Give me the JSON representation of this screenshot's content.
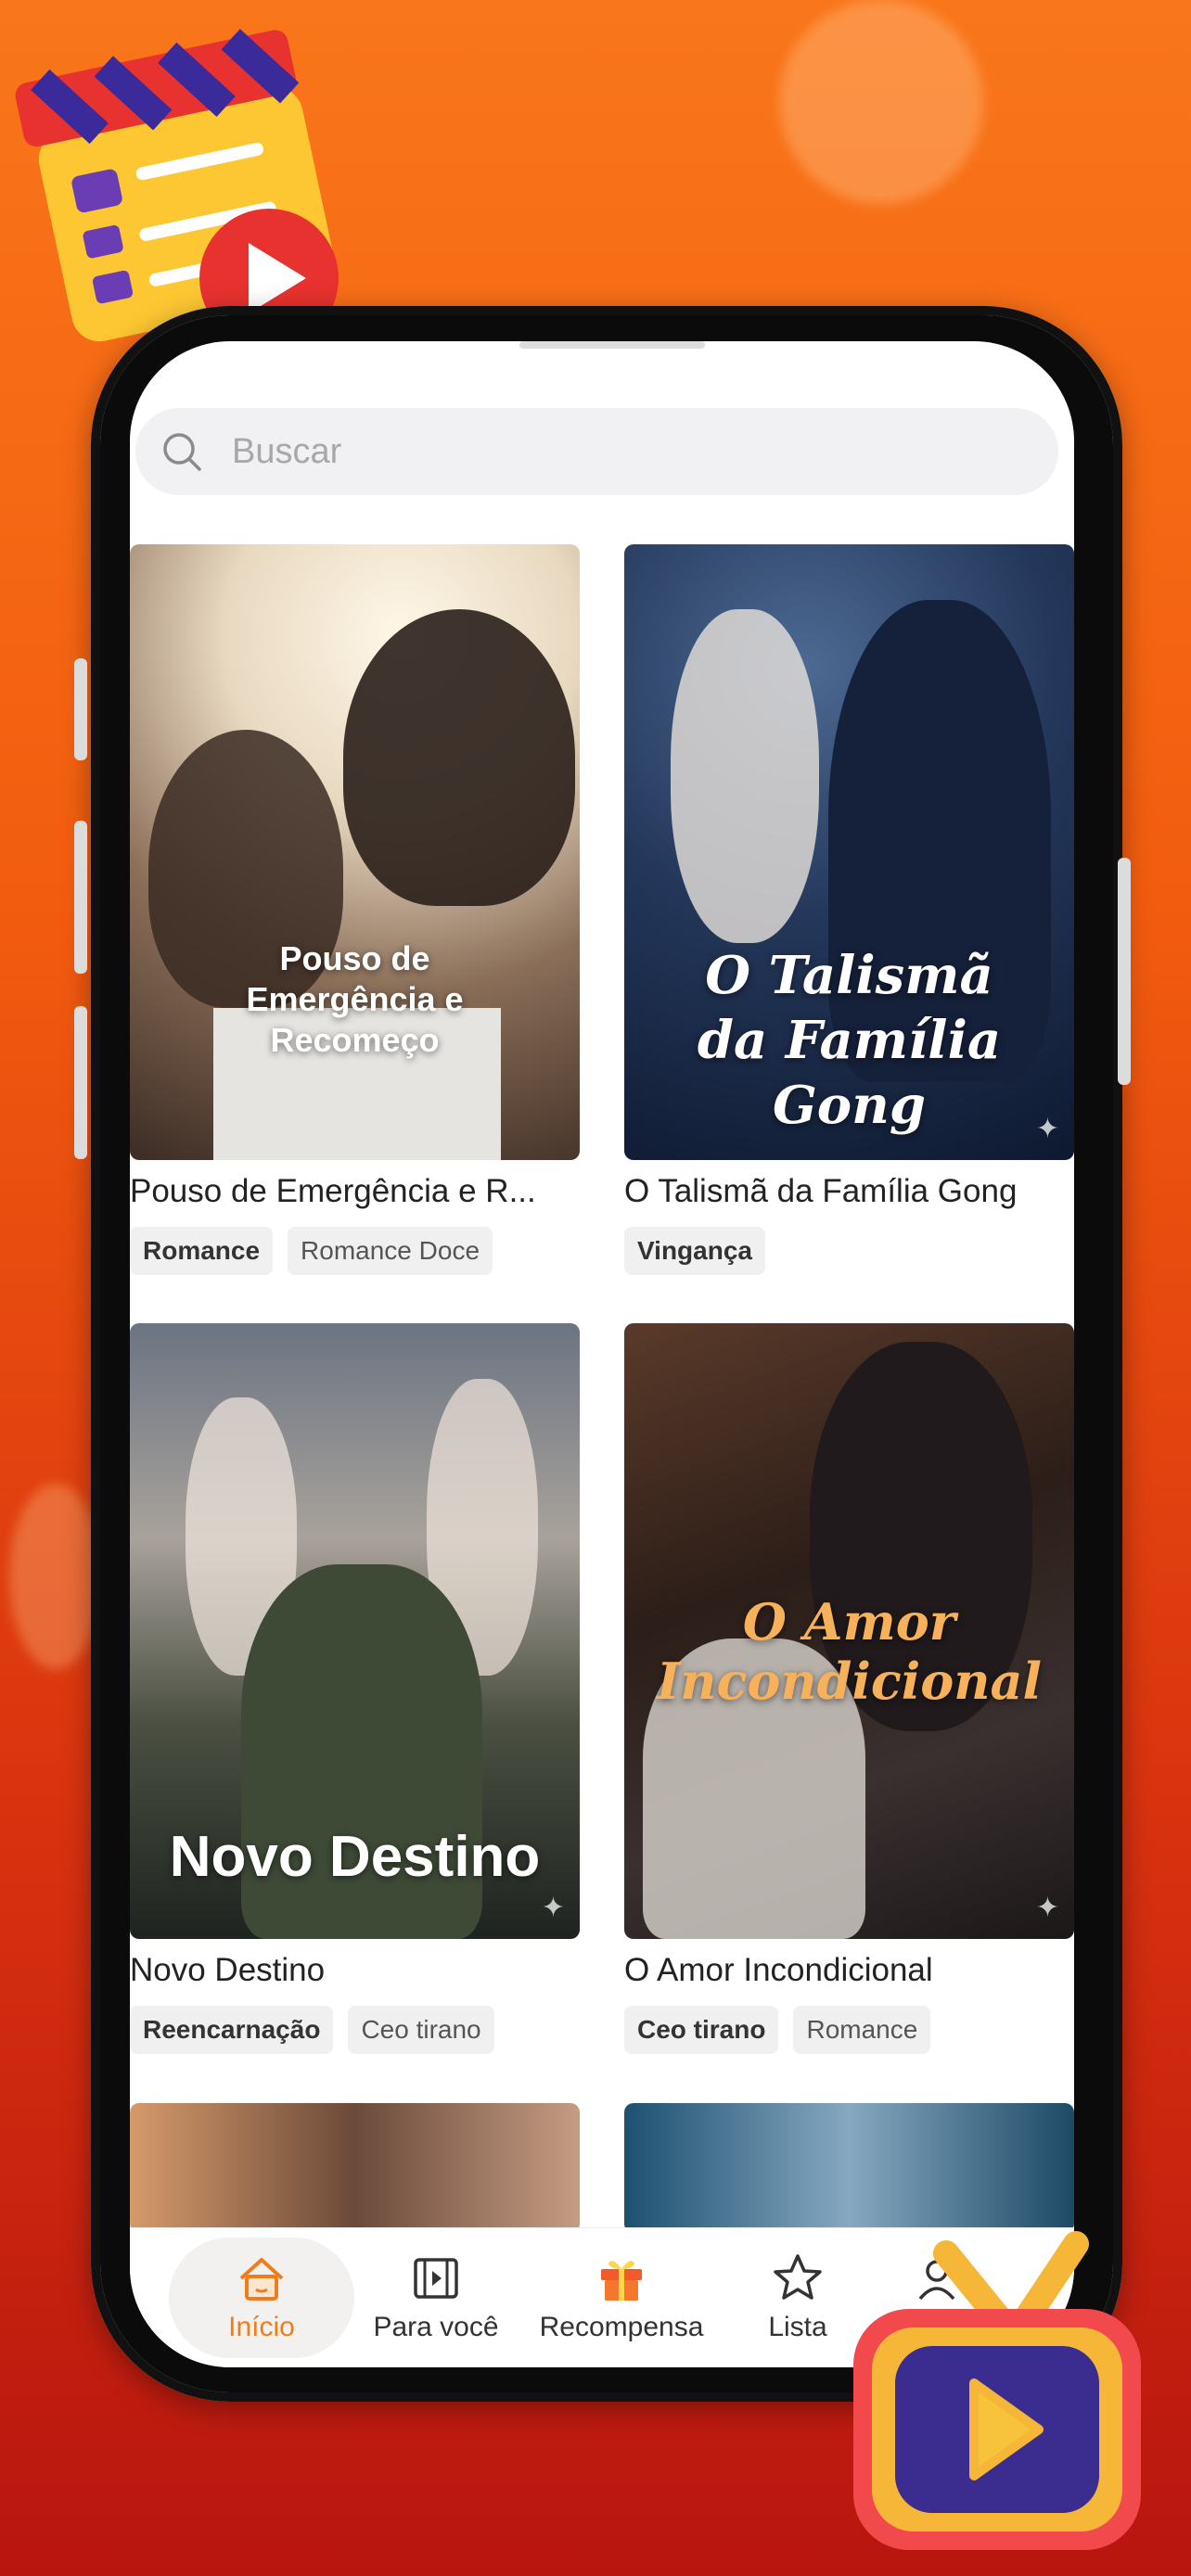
{
  "search": {
    "placeholder": "Buscar"
  },
  "cards": [
    {
      "poster_text": "Pouso de Emergência e Recomeço",
      "title": "Pouso de Emergência e R...",
      "tags": [
        "Romance",
        "Romance Doce"
      ]
    },
    {
      "poster_text": "O Talismã da Família Gong",
      "title": "O Talismã da Família Gong",
      "tags": [
        "Vingança"
      ]
    },
    {
      "poster_text": "Novo Destino",
      "title": "Novo Destino",
      "tags": [
        "Reencarnação",
        "Ceo tirano"
      ]
    },
    {
      "poster_text": "O Amor Incondicional",
      "title": "O Amor Incondicional",
      "tags": [
        "Ceo tirano",
        "Romance"
      ]
    }
  ],
  "nav": {
    "items": [
      {
        "label": "Início",
        "icon": "home-icon",
        "active": true
      },
      {
        "label": "Para você",
        "icon": "film-icon",
        "active": false
      },
      {
        "label": "Recompensa",
        "icon": "gift-icon",
        "active": false
      },
      {
        "label": "Lista",
        "icon": "star-icon",
        "active": false
      }
    ]
  },
  "colors": {
    "accent": "#f07d1a",
    "background_top": "#f9761a",
    "background_bottom": "#b8150f"
  }
}
